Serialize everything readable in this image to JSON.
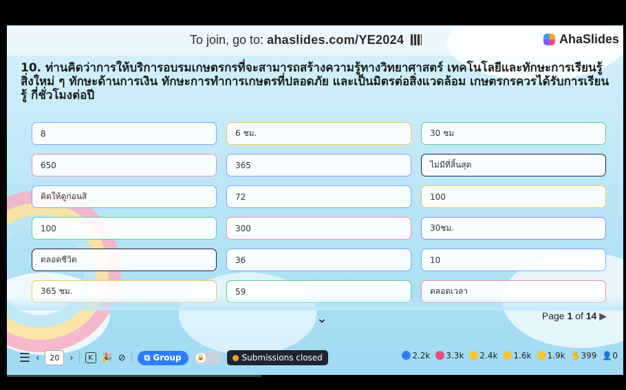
{
  "header": {
    "join_prefix": "To join, go to: ",
    "join_url": "ahaslides.com/YE2024",
    "logo_text": "AhaSlides"
  },
  "question": {
    "text": "10. ท่านคิดว่าการให้บริการอบรมเกษตรกรที่จะสามารถสร้างความรู้ทางวิทยาศาสตร์ เทคโนโลยีและทักษะการเรียนรู้สิ่งใหม่ ๆ ทักษะด้านการเงิน ทักษะการทำการเกษตรที่ปลอดภัย และเป็นมิตรต่อสิ่งแวดล้อม เกษตรกรควรได้รับการเรียนรู้ กี่ชั่วโมงต่อปี"
  },
  "responses": [
    {
      "text": "8",
      "color": "#7aa7ff"
    },
    {
      "text": "6 ชม.",
      "color": "#f5c451"
    },
    {
      "text": "30 ชม",
      "color": "#5ccf8f"
    },
    {
      "text": "650",
      "color": "#f08bb5"
    },
    {
      "text": "365",
      "color": "#7aa7ff"
    },
    {
      "text": "ไม่มีที่สิ้นสุด",
      "color": "#1e2430"
    },
    {
      "text": "คิดให้ดูก่อนสิ",
      "color": "#7aa7ff"
    },
    {
      "text": "72",
      "color": "#7aa7ff"
    },
    {
      "text": "100",
      "color": "#f5c451"
    },
    {
      "text": "100",
      "color": "#5ccf8f"
    },
    {
      "text": "300",
      "color": "#f08bb5"
    },
    {
      "text": "30ชม.",
      "color": "#9b7bff"
    },
    {
      "text": "ตลอดชีวิต",
      "color": "#1e2430"
    },
    {
      "text": "36",
      "color": "#7aa7ff"
    },
    {
      "text": "10",
      "color": "#7aa7ff"
    },
    {
      "text": "365 ชม.",
      "color": "#f5c451"
    },
    {
      "text": "59",
      "color": "#5ccf8f"
    },
    {
      "text": "ตลอดเวลา",
      "color": "#f08bb5"
    }
  ],
  "pagination": {
    "prefix": "Page ",
    "current": "1",
    "middle": " of ",
    "total": "14"
  },
  "toolbar": {
    "slide_number": "20",
    "k_label": "K",
    "group_label": "Group",
    "submissions_label": "Submissions closed"
  },
  "reactions": {
    "like": "2.2k",
    "heart": "3.3k",
    "laugh": "2.4k",
    "wow": "1.6k",
    "sad": "1.9k",
    "hands": "399",
    "participants": "0"
  }
}
